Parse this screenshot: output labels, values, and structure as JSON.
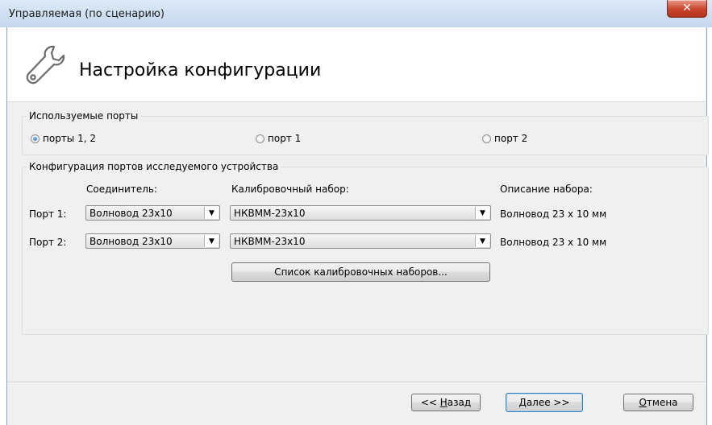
{
  "window": {
    "title": "Управляемая (по сценарию)",
    "close_glyph": "✕"
  },
  "header": {
    "title": "Настройка конфигурации",
    "icon": "wrench-icon"
  },
  "ports_group": {
    "legend": "Используемые порты",
    "options": [
      {
        "label": "порты 1, 2",
        "checked": true
      },
      {
        "label": "порт 1",
        "checked": false
      },
      {
        "label": "порт 2",
        "checked": false
      }
    ]
  },
  "config_group": {
    "legend": "Конфигурация портов исследуемого устройства",
    "col_connector": "Соединитель:",
    "col_calkit": "Калибровочный набор:",
    "col_description": "Описание набора:",
    "rows": [
      {
        "port": "Порт 1:",
        "connector": "Волновод 23x10",
        "calkit": "НКВММ-23x10",
        "description": "Волновод 23 x 10 мм"
      },
      {
        "port": "Порт 2:",
        "connector": "Волновод 23x10",
        "calkit": "НКВММ-23x10",
        "description": "Волновод 23 x 10 мм"
      }
    ],
    "calkit_list_button": "Список калибровочных наборов..."
  },
  "footer": {
    "back_prefix": "<< ",
    "back_mnemonic": "Н",
    "back_rest": "азад",
    "next_label": "Далее >>",
    "cancel_mnemonic": "О",
    "cancel_rest": "тмена"
  }
}
